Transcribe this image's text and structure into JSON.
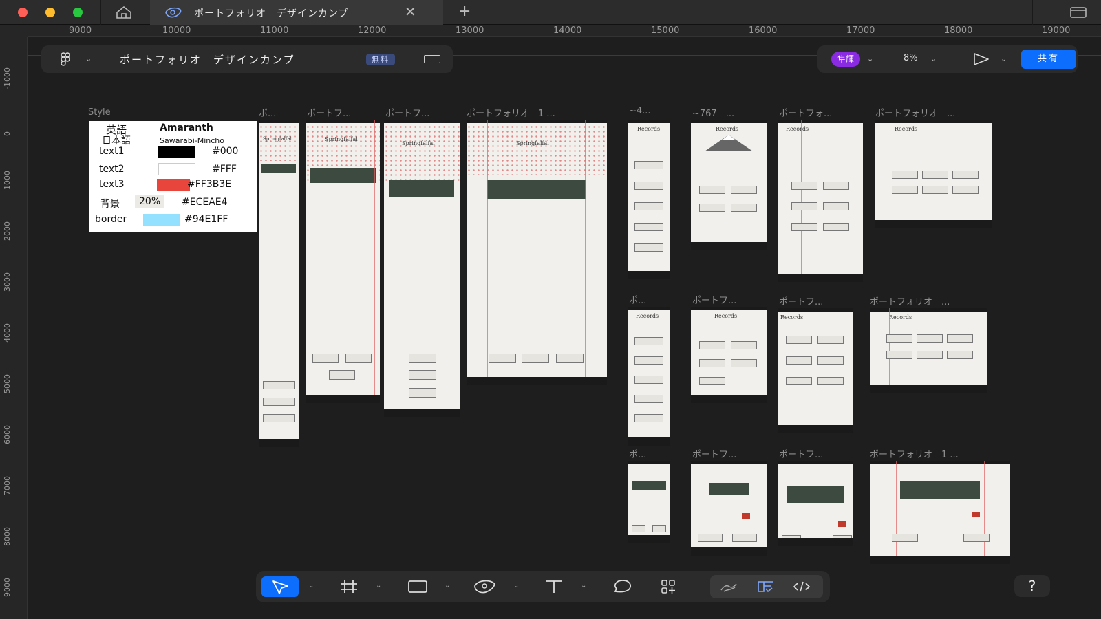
{
  "window": {
    "tab_title": "ポートフォリオ　デザインカンプ",
    "close_glyph": "✕",
    "new_tab_glyph": "+"
  },
  "ruler": {
    "top": [
      "9000",
      "10000",
      "11000",
      "12000",
      "13000",
      "14000",
      "15000",
      "16000",
      "17000",
      "18000",
      "19000"
    ],
    "left": [
      "-1000",
      "0",
      "1000",
      "2000",
      "3000",
      "4000",
      "5000",
      "6000",
      "7000",
      "8000",
      "9000"
    ]
  },
  "toolbar_top": {
    "file_name": "ポートフォリオ　デザインカンプ",
    "plan_badge": "無料",
    "avatar_text": "隼輝",
    "zoom": "8%",
    "share_label": "共有"
  },
  "style_panel": {
    "label": "Style",
    "rows": [
      {
        "name": "英語",
        "value": "Amaranth"
      },
      {
        "name": "日本語",
        "value": "Sawarabi-Mincho"
      },
      {
        "name": "text1",
        "value": "#000",
        "color": "#000000"
      },
      {
        "name": "text2",
        "value": "#FFF",
        "color": "#FFFFFF"
      },
      {
        "name": "text3",
        "value": "#FF3B3E",
        "color": "#E8453C"
      },
      {
        "name": "背景",
        "percent": "20%",
        "value": "#ECEAE4"
      },
      {
        "name": "border",
        "value": "#94E1FF",
        "color": "#94E1FF"
      }
    ]
  },
  "frames": [
    {
      "title": "ポ..."
    },
    {
      "title": "ポートフ..."
    },
    {
      "title": "ポートフ..."
    },
    {
      "title": "ポートフォリオ　1 ..."
    },
    {
      "title": "~4..."
    },
    {
      "title": "~767　..."
    },
    {
      "title": "ポートフォ..."
    },
    {
      "title": "ポートフォリオ　..."
    },
    {
      "title": "ポ..."
    },
    {
      "title": "ポートフ..."
    },
    {
      "title": "ポートフ..."
    },
    {
      "title": "ポートフォリオ　..."
    },
    {
      "title": "ポ..."
    },
    {
      "title": "ポートフ..."
    },
    {
      "title": "ポートフ..."
    },
    {
      "title": "ポートフォリオ　1 ..."
    }
  ],
  "frame_texts": {
    "logo": "Springfalfal",
    "records": "Records"
  },
  "help": "?",
  "colors": {
    "accent": "#0d6efd",
    "avatar": "#8a2be2"
  },
  "icons": [
    "home-icon",
    "figma-menu-icon",
    "sidebar-toggle-icon",
    "play-icon",
    "move-tool-icon",
    "frame-tool-icon",
    "rectangle-tool-icon",
    "pen-tool-icon",
    "text-tool-icon",
    "comment-tool-icon",
    "actions-icon",
    "draw-mode-icon",
    "design-mode-icon",
    "dev-mode-icon"
  ]
}
